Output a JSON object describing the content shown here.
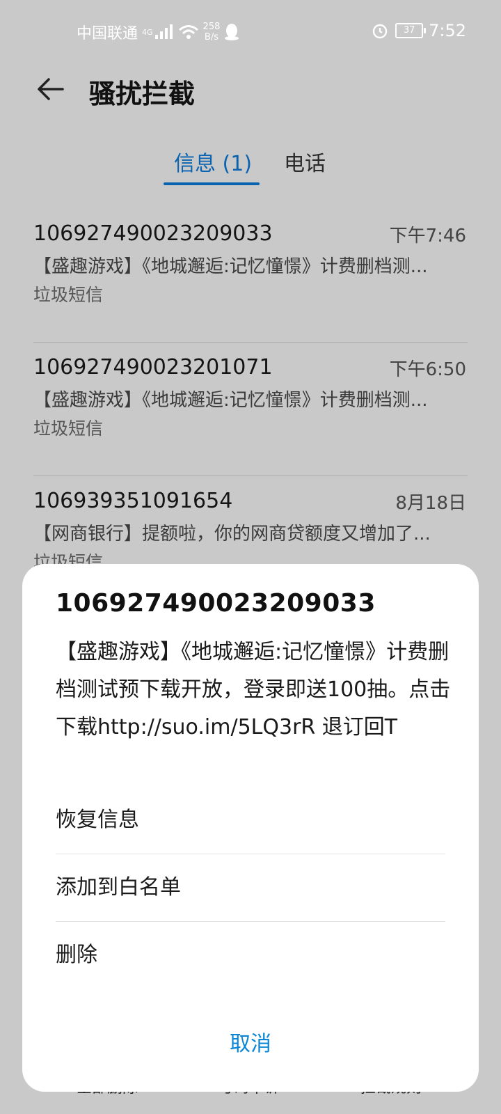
{
  "status": {
    "carrier": "中国联通",
    "net_type": "4G",
    "net_speed_value": "258",
    "net_speed_unit": "B/s",
    "battery": "37",
    "time": "7:52",
    "icons": [
      "signal-icon",
      "wifi-icon",
      "qq-icon",
      "alarm-icon",
      "battery-icon"
    ]
  },
  "header": {
    "title": "骚扰拦截",
    "back_icon": "arrow-left-icon"
  },
  "tabs": [
    {
      "label": "信息 (1)",
      "active": true
    },
    {
      "label": "电话",
      "active": false
    }
  ],
  "messages": [
    {
      "number": "106927490023209033",
      "time": "下午7:46",
      "preview": "【盛趣游戏】《地城邂逅:记忆憧憬》计费删档测...",
      "tag": "垃圾短信"
    },
    {
      "number": "106927490023201071",
      "time": "下午6:50",
      "preview": "【盛趣游戏】《地城邂逅:记忆憧憬》计费删档测...",
      "tag": "垃圾短信"
    },
    {
      "number": "106939351091654",
      "time": "8月18日",
      "preview": "【网商银行】提额啦，你的网商贷额度又增加了...",
      "tag": "垃圾短信"
    }
  ],
  "bottom_bar": {
    "items": [
      "全部删除",
      "号码申诉",
      "拦截规则"
    ]
  },
  "sheet": {
    "title": "106927490023209033",
    "body": "【盛趣游戏】《地城邂逅:记忆憧憬》计费删档测试预下载开放，登录即送100抽。点击下载http://suo.im/5LQ3rR 退订回T",
    "actions": [
      "恢复信息",
      "添加到白名单",
      "删除"
    ],
    "cancel": "取消"
  },
  "colors": {
    "accent": "#0a63b0",
    "cancel": "#0a86d9",
    "overlay_bg": "#c9c9c9"
  }
}
